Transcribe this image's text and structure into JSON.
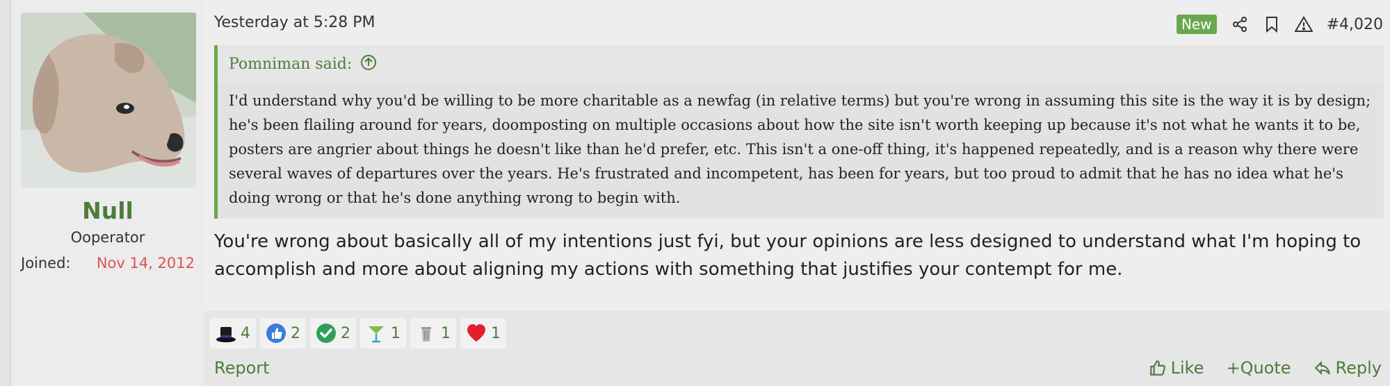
{
  "user": {
    "name": "Null",
    "title": "Ooperator",
    "joined_label": "Joined:",
    "joined_value": "Nov 14, 2012"
  },
  "post": {
    "timestamp": "Yesterday at 5:28 PM",
    "badge": "New",
    "number": "#4,020",
    "quote_author": "Pomniman said:",
    "quote_text": "I'd understand why you'd be willing to be more charitable as a newfag (in relative terms) but you're wrong in assuming this site is the way it is by design; he's been flailing around for years, doomposting on multiple occasions about how the site isn't worth keeping up because it's not what he wants it to be, posters are angrier about things he doesn't like than he'd prefer, etc. This isn't a one-off thing, it's happened repeatedly, and is a reason why there were several waves of departures over the years. He's frustrated and incompetent, has been for years, but too proud to admit that he has no idea what he's doing wrong or that he's done anything wrong to begin with.",
    "message": "You're wrong about basically all of my intentions just fyi, but your opinions are less designed to understand what I'm hoping to accomplish and more about aligning my actions with something that justifies your contempt for me."
  },
  "reactions": [
    {
      "icon": "top-hat-icon",
      "count": "4"
    },
    {
      "icon": "thumbs-up-icon",
      "count": "2"
    },
    {
      "icon": "checkmark-icon",
      "count": "2"
    },
    {
      "icon": "cocktail-icon",
      "count": "1"
    },
    {
      "icon": "trash-can-icon",
      "count": "1"
    },
    {
      "icon": "heart-icon",
      "count": "1"
    }
  ],
  "footer": {
    "report": "Report",
    "like": "Like",
    "quote": "+Quote",
    "reply": "Reply"
  },
  "colors": {
    "accent": "#4d7c3b",
    "badge_bg": "#6aa84f",
    "joined_date": "#d9534f"
  }
}
